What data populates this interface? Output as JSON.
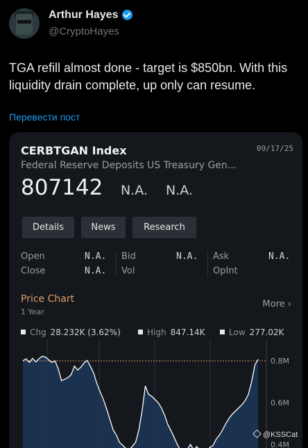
{
  "tweet": {
    "author_name": "Arthur Hayes",
    "author_handle": "@CryptoHayes",
    "text": "TGA refill almost done - target is $850bn. With this liquidity drain complete, up only can resume.",
    "translate_label": "Перевести пост"
  },
  "card": {
    "ticker": "CERBTGAN Index",
    "date": "09/17/25",
    "description": "Federal Reserve Deposits US Treasury Gen...",
    "price": "807142",
    "na1": "N.A.",
    "na2": "N.A.",
    "buttons": {
      "details": "Details",
      "news": "News",
      "research": "Research"
    },
    "stats": {
      "open_label": "Open",
      "open_value": "N.A.",
      "close_label": "Close",
      "close_value": "N.A.",
      "bid_label": "Bid",
      "bid_value": "N.A.",
      "vol_label": "Vol",
      "ask_label": "Ask",
      "ask_value": "N.A.",
      "opint_label": "OpInt"
    },
    "price_chart": {
      "title": "Price Chart",
      "subtitle": "1 Year",
      "more_label": "More",
      "legend": {
        "chg_label": "Chg",
        "chg_value": "28.232K (3.62%)",
        "high_label": "High",
        "high_value": "847.14K",
        "low_label": "Low",
        "low_value": "277.02K"
      }
    }
  },
  "watermark": "@KSSCat",
  "colors": {
    "accent_blue": "#1d9bf0",
    "chart_fill": "#1b3150",
    "chart_line": "#ffffff",
    "title_orange": "#d9a06a"
  },
  "chart_data": {
    "type": "area",
    "title": "Price Chart",
    "subtitle": "1 Year",
    "y_ticks": [
      "0.8M",
      "0.6M",
      "0.4M"
    ],
    "y_tick_values": [
      800000,
      600000,
      400000
    ],
    "ylim": [
      330000,
      860000
    ],
    "reference_line": 800000,
    "values": [
      800000,
      810000,
      792000,
      812000,
      795000,
      810000,
      822000,
      818000,
      805000,
      792000,
      800000,
      760000,
      705000,
      712000,
      720000,
      735000,
      775000,
      756000,
      770000,
      790000,
      802000,
      772000,
      740000,
      690000,
      650000,
      615000,
      570000,
      520000,
      470000,
      445000,
      410000,
      395000,
      380000,
      372000,
      392000,
      410000,
      470000,
      560000,
      680000,
      640000,
      630000,
      615000,
      600000,
      575000,
      540000,
      495000,
      465000,
      432000,
      398000,
      372000,
      355000,
      375000,
      400000,
      375000,
      390000,
      372000,
      375000,
      370000,
      385000,
      395000,
      425000,
      445000,
      470000,
      500000,
      525000,
      545000,
      560000,
      575000,
      590000,
      610000,
      640000,
      700000,
      780000,
      807142
    ],
    "grid": true
  }
}
